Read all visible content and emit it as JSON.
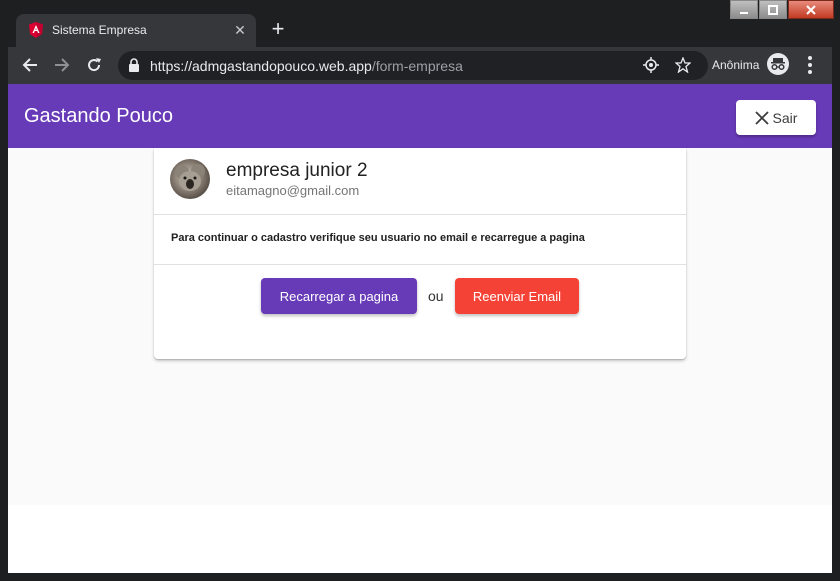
{
  "browser": {
    "tab_title": "Sistema Empresa",
    "url_host": "https://admgastandopouco.web.app",
    "url_path": "/form-empresa",
    "incognito_label": "Anônima"
  },
  "app": {
    "title": "Gastando Pouco",
    "logout_label": "Sair",
    "primary_color": "#673ab7",
    "warn_color": "#f44336"
  },
  "card": {
    "title": "empresa junior 2",
    "subtitle": "eitamagno@gmail.com",
    "message": "Para continuar o cadastro verifique seu usuario no email e recarregue a pagina",
    "reload_label": "Recarregar a pagina",
    "or_label": "ou",
    "resend_label": "Reenviar Email"
  }
}
